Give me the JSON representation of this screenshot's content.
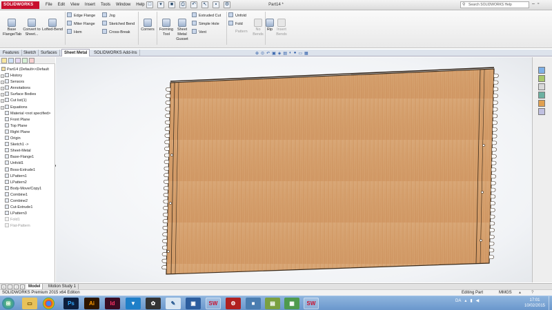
{
  "app": {
    "brand": "SOLIDWORKS",
    "document_title": "Part14 *"
  },
  "menu": [
    "File",
    "Edit",
    "View",
    "Insert",
    "Tools",
    "Window",
    "Help"
  ],
  "search": {
    "placeholder": "Search SOLIDWORKS Help"
  },
  "commands": {
    "base_flange": "Base Flange/Tab",
    "convert": "Convert to Sheet...",
    "lofted_bend": "Lofted-Bend",
    "edge_flange": "Edge Flange",
    "miter_flange": "Miter Flange",
    "hem": "Hem",
    "jog": "Jog",
    "sketched_bend": "Sketched Bend",
    "cross_break": "Cross-Break",
    "corners": "Corners",
    "forming_tool": "Forming Tool",
    "gusset": "Sheet Metal Gusset",
    "extruded_cut": "Extruded Cut",
    "simple_hole": "Simple Hole",
    "vent": "Vent",
    "unfold": "Unfold",
    "fold": "Fold",
    "pattern": "Pattern",
    "no_bends": "No Bends",
    "rip": "Rip",
    "insert_bends": "Insert Bends"
  },
  "tabs": [
    "Features",
    "Sketch",
    "Surfaces",
    "Sheet Metal",
    "SOLIDWORKS Add-Ins"
  ],
  "active_tab": "Sheet Metal",
  "tree": {
    "root": "Part14  (Default<<Default",
    "items": [
      {
        "label": "History",
        "icon": "folder-icon",
        "state": "normal"
      },
      {
        "label": "Sensors",
        "icon": "sensor-icon",
        "state": "normal"
      },
      {
        "label": "Annotations",
        "icon": "annotation-icon",
        "state": "normal"
      },
      {
        "label": "Surface Bodies",
        "icon": "surface-bodies-icon",
        "state": "normal"
      },
      {
        "label": "Cut list(1)",
        "icon": "cut-list-icon",
        "state": "normal"
      },
      {
        "label": "Equations",
        "icon": "equations-icon",
        "state": "normal"
      },
      {
        "label": "Material <not specified>",
        "icon": "material-icon",
        "state": "normal"
      },
      {
        "label": "Front Plane",
        "icon": "plane-icon",
        "state": "normal"
      },
      {
        "label": "Top Plane",
        "icon": "plane-icon",
        "state": "normal"
      },
      {
        "label": "Right Plane",
        "icon": "plane-icon",
        "state": "normal"
      },
      {
        "label": "Origin",
        "icon": "origin-icon",
        "state": "normal"
      },
      {
        "label": "Sketch1 ->",
        "icon": "sketch-icon",
        "state": "normal"
      },
      {
        "label": "Sheet-Metal",
        "icon": "sheet-metal-icon",
        "state": "normal"
      },
      {
        "label": "Base-Flange1",
        "icon": "base-flange-icon",
        "state": "normal"
      },
      {
        "label": "Unfold1",
        "icon": "unfold-icon",
        "state": "normal"
      },
      {
        "label": "Boss-Extrude1",
        "icon": "extrude-icon",
        "state": "normal"
      },
      {
        "label": "LPattern1",
        "icon": "pattern-icon",
        "state": "normal"
      },
      {
        "label": "LPattern2",
        "icon": "pattern-icon",
        "state": "normal"
      },
      {
        "label": "Body-Move/Copy1",
        "icon": "move-copy-icon",
        "state": "normal"
      },
      {
        "label": "Combine1",
        "icon": "combine-icon",
        "state": "normal"
      },
      {
        "label": "Combine2",
        "icon": "combine-icon",
        "state": "normal"
      },
      {
        "label": "Cut-Extrude1",
        "icon": "cut-extrude-icon",
        "state": "normal"
      },
      {
        "label": "LPattern3",
        "icon": "pattern-icon",
        "state": "normal"
      },
      {
        "label": "Fold1",
        "icon": "fold-icon",
        "state": "suppressed"
      },
      {
        "label": "Flat-Pattern",
        "icon": "flat-pattern-icon",
        "state": "suppressed"
      }
    ]
  },
  "bottom_tabs": [
    "Model",
    "Motion Study 1"
  ],
  "status": {
    "left": "SOLIDWORKS Premium 2015 x64 Edition",
    "mode": "Editing Part",
    "units": "MMGS"
  },
  "taskbar": {
    "apps": [
      "start-orb-icon",
      "explorer-icon",
      "chrome-icon",
      "photoshop-icon",
      "illustrator-icon",
      "indesign-icon",
      "vectorworks-icon",
      "inkscape-icon",
      "paint-icon",
      "virtualbox-icon",
      "solidworks-icon",
      "settings-icon",
      "app-icon",
      "notepad-icon",
      "solidworks-icon"
    ],
    "app_labels": {
      "photoshop": "Ps",
      "illustrator": "Ai",
      "indesign": "Id"
    },
    "lang": "DA",
    "time": "17:01",
    "date": "10/02/2015"
  },
  "colors": {
    "wood": "#d6a070",
    "brand_red": "#c8102e",
    "taskbar": "#7aa5d6",
    "active_tab": "#ffffff"
  }
}
